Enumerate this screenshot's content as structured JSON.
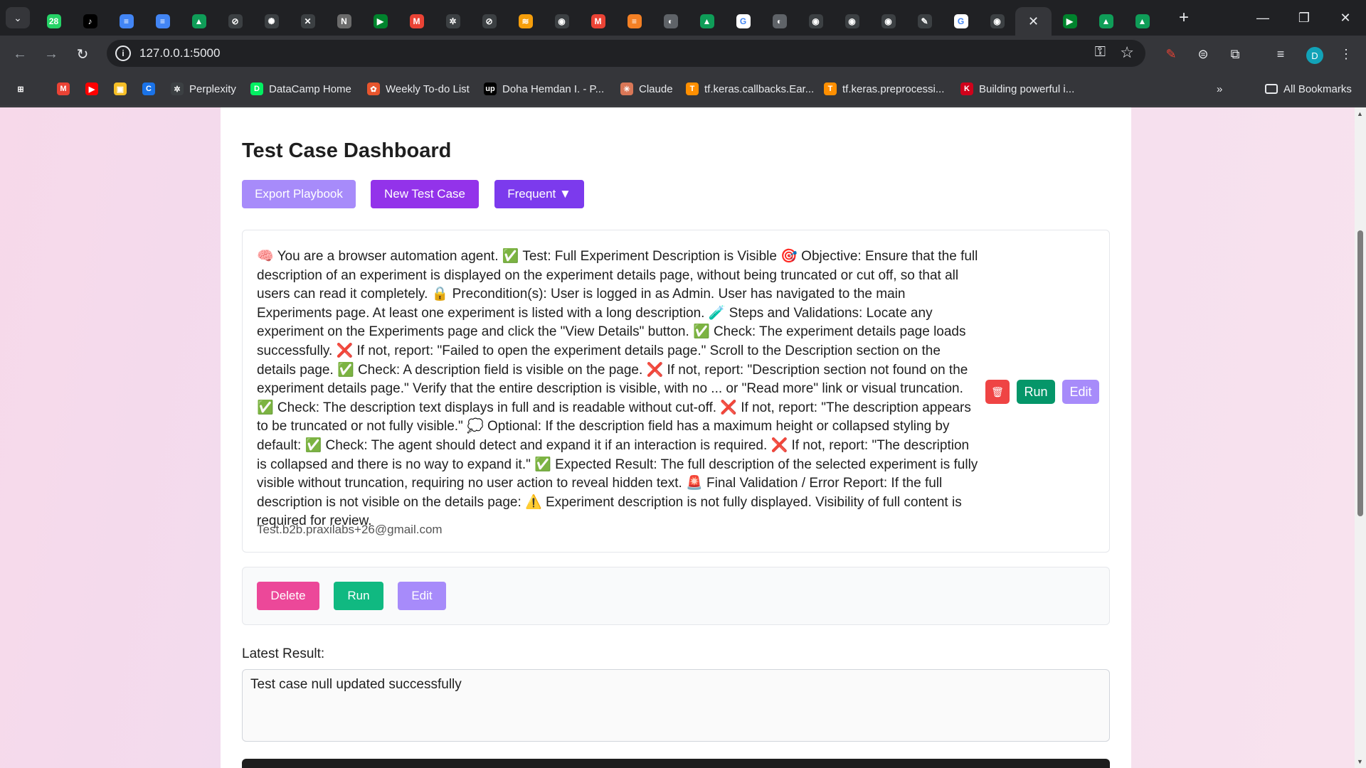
{
  "browser": {
    "tabs": [
      {
        "icon": "whatsapp-icon",
        "color": "#25d366",
        "glyph": "28"
      },
      {
        "icon": "tiktok-icon",
        "color": "#000000",
        "glyph": "♪"
      },
      {
        "icon": "docs-icon",
        "color": "#4285f4",
        "glyph": "≡"
      },
      {
        "icon": "docs-icon",
        "color": "#4285f4",
        "glyph": "≡"
      },
      {
        "icon": "drive-icon",
        "color": "#0f9d58",
        "glyph": "▲"
      },
      {
        "icon": "openai-icon",
        "color": "#3c4043",
        "glyph": "⊘"
      },
      {
        "icon": "chatgpt-icon",
        "color": "#3c4043",
        "glyph": "✺"
      },
      {
        "icon": "x-icon",
        "color": "#3c4043",
        "glyph": "✕"
      },
      {
        "icon": "notion-icon",
        "color": "#6b6b6b",
        "glyph": "N"
      },
      {
        "icon": "meet-icon",
        "color": "#00832d",
        "glyph": "▶"
      },
      {
        "icon": "gmail-icon",
        "color": "#ea4335",
        "glyph": "M"
      },
      {
        "icon": "perplexity-icon",
        "color": "#3c4043",
        "glyph": "✲"
      },
      {
        "icon": "openai-icon",
        "color": "#3c4043",
        "glyph": "⊘"
      },
      {
        "icon": "stack-icon",
        "color": "#f59e0b",
        "glyph": "≋"
      },
      {
        "icon": "github-icon",
        "color": "#3c4043",
        "glyph": "◉"
      },
      {
        "icon": "gmail-icon",
        "color": "#ea4335",
        "glyph": "M"
      },
      {
        "icon": "stackoverflow-icon",
        "color": "#f48024",
        "glyph": "≡"
      },
      {
        "icon": "globe-icon",
        "color": "#5f6368",
        "glyph": "◐"
      },
      {
        "icon": "drive-icon",
        "color": "#0f9d58",
        "glyph": "▲"
      },
      {
        "icon": "google-icon",
        "color": "#ffffff",
        "glyph": "G"
      },
      {
        "icon": "globe-icon",
        "color": "#5f6368",
        "glyph": "◐"
      },
      {
        "icon": "github-icon",
        "color": "#3c4043",
        "glyph": "◉"
      },
      {
        "icon": "github-icon",
        "color": "#3c4043",
        "glyph": "◉"
      },
      {
        "icon": "github-icon",
        "color": "#3c4043",
        "glyph": "◉"
      },
      {
        "icon": "flask-icon",
        "color": "#3c4043",
        "glyph": "✎"
      },
      {
        "icon": "google-icon",
        "color": "#ffffff",
        "glyph": "G"
      },
      {
        "icon": "github-icon",
        "color": "#3c4043",
        "glyph": "◉"
      },
      {
        "icon": "close-icon",
        "color": "#35363a",
        "glyph": "✕",
        "active": true
      },
      {
        "icon": "meet-icon",
        "color": "#00832d",
        "glyph": "▶"
      },
      {
        "icon": "drive-icon",
        "color": "#0f9d58",
        "glyph": "▲"
      },
      {
        "icon": "drive-icon",
        "color": "#0f9d58",
        "glyph": "▲"
      }
    ],
    "url": "127.0.0.1:5000",
    "profile_initial": "D",
    "bookmarks": [
      {
        "label": "",
        "icon": "apps-grid-icon",
        "color": "#35363a",
        "glyph": "⊞"
      },
      {
        "label": "",
        "icon": "gmail-icon",
        "color": "#ea4335",
        "glyph": "M"
      },
      {
        "label": "",
        "icon": "youtube-icon",
        "color": "#ff0000",
        "glyph": "▶"
      },
      {
        "label": "",
        "icon": "classroom-icon",
        "color": "#f6bf26",
        "glyph": "▣"
      },
      {
        "label": "",
        "icon": "c-icon",
        "color": "#1a73e8",
        "glyph": "C"
      },
      {
        "label": "Perplexity",
        "icon": "perplexity-icon",
        "color": "#3c4043",
        "glyph": "✲"
      },
      {
        "label": "DataCamp Home",
        "icon": "datacamp-icon",
        "color": "#03ef62",
        "glyph": "D"
      },
      {
        "label": "Weekly To-do List",
        "icon": "todo-icon",
        "color": "#e8552d",
        "glyph": "✿"
      },
      {
        "label": "Doha Hemdan I. - P...",
        "icon": "upwork-icon",
        "color": "#000000",
        "glyph": "up"
      },
      {
        "label": "Claude",
        "icon": "claude-icon",
        "color": "#d97757",
        "glyph": "✳"
      },
      {
        "label": "tf.keras.callbacks.Ear...",
        "icon": "tensorflow-icon",
        "color": "#ff8f00",
        "glyph": "T"
      },
      {
        "label": "tf.keras.preprocessi...",
        "icon": "tensorflow-icon",
        "color": "#ff8f00",
        "glyph": "T"
      },
      {
        "label": "Building powerful i...",
        "icon": "kaggle-icon",
        "color": "#d0021b",
        "glyph": "K"
      }
    ],
    "all_bookmarks": "All Bookmarks"
  },
  "page": {
    "title": "Test Case Dashboard",
    "export_label": "Export Playbook",
    "new_label": "New Test Case",
    "frequent_label": "Frequent ▼",
    "test_case": {
      "description": "🧠 You are a browser automation agent. ✅ Test: Full Experiment Description is Visible 🎯 Objective: Ensure that the full description of an experiment is displayed on the experiment details page, without being truncated or cut off, so that all users can read it completely. 🔒 Precondition(s): User is logged in as Admin. User has navigated to the main Experiments page. At least one experiment is listed with a long description. 🧪 Steps and Validations: Locate any experiment on the Experiments page and click the \"View Details\" button. ✅ Check: The experiment details page loads successfully. ❌ If not, report: \"Failed to open the experiment details page.\" Scroll to the Description section on the details page. ✅ Check: A description field is visible on the page. ❌ If not, report: \"Description section not found on the experiment details page.\" Verify that the entire description is visible, with no ... or \"Read more\" link or visual truncation. ✅ Check: The description text displays in full and is readable without cut-off. ❌ If not, report: \"The description appears to be truncated or not fully visible.\" 💭 Optional: If the description field has a maximum height or collapsed styling by default: ✅ Check: The agent should detect and expand it if an interaction is required. ❌ If not, report: \"The description is collapsed and there is no way to expand it.\" ✅ Expected Result: The full description of the selected experiment is fully visible without truncation, requiring no user action to reveal hidden text. 🚨 Final Validation / Error Report: If the full description is not visible on the details page: ⚠️ Experiment description is not fully displayed. Visibility of full content is required for review.",
      "email": "Test.b2b.praxilabs+26@gmail.com",
      "run_label": "Run",
      "edit_label": "Edit"
    },
    "actions": {
      "delete_label": "Delete",
      "run_label": "Run",
      "edit_label": "Edit"
    },
    "latest_result_label": "Latest Result:",
    "latest_result_text": "Test case null updated successfully"
  }
}
